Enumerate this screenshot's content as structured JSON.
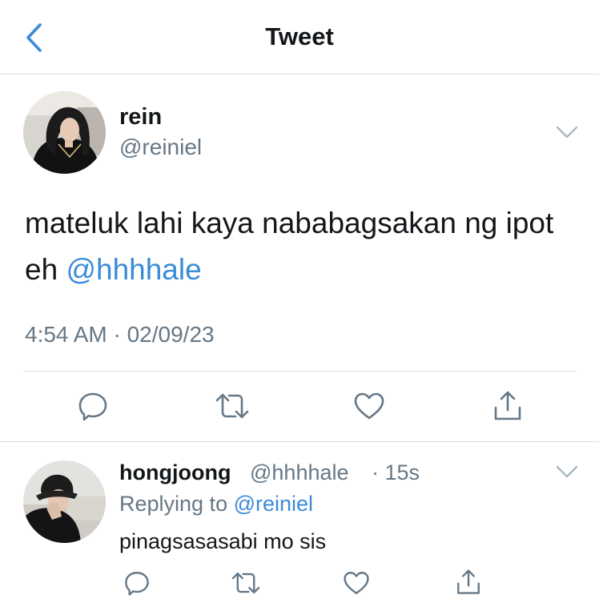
{
  "header": {
    "title": "Tweet"
  },
  "tweet": {
    "name": "rein",
    "handle": "@reiniel",
    "text_before": "mateluk lahi kaya nababagsakan ng ipot eh ",
    "mention": "@hhhhale",
    "timestamp": "4:54 AM · 02/09/23"
  },
  "reply": {
    "name": "hongjoong",
    "handle": "@hhhhale",
    "time": "· 15s",
    "replying_prefix": "Replying to ",
    "replying_handle": "@reiniel",
    "text": "pinagsasasabi mo sis"
  },
  "colors": {
    "accent": "#3a8bd8",
    "secondary": "#657786",
    "icon": "#657786",
    "divider": "#d9dde1"
  },
  "icons": [
    "back-chevron-icon",
    "chevron-down-icon",
    "reply-icon",
    "retweet-icon",
    "like-icon",
    "share-icon"
  ]
}
